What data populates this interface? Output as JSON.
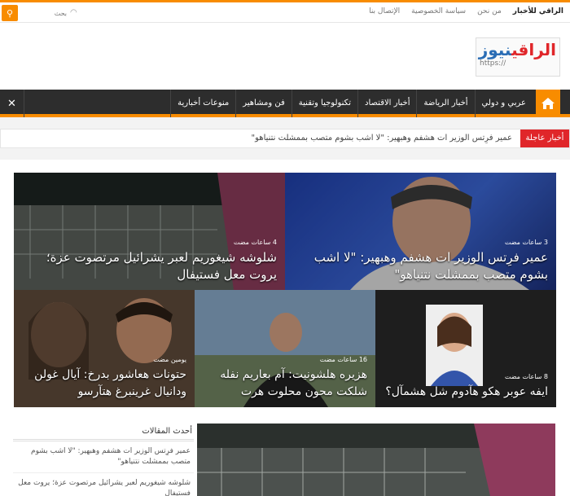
{
  "topbar": {
    "links": [
      "الراقي للأخبار",
      "من نحن",
      "سياسة الخصوصية",
      "الإتصال بنا"
    ],
    "search_placeholder": "بحث"
  },
  "logo": {
    "part1": "الراقي",
    "part2": "نيوز",
    "url": "https://"
  },
  "nav": {
    "items": [
      "عربي و دولي",
      "أخبار الرياضة",
      "أخبار الاقتصاد",
      "تكنولوجيا وتقنية",
      "فن ومشاهير",
      "منوعات أخبارية"
    ]
  },
  "ticker": {
    "label": "أخبار عاجلة",
    "text": "عمير فرِتس الوزير ات هشفم وهبهير: \"لا اشب بشوم متصب بممشلت نتنياهو\""
  },
  "tiles": [
    {
      "time": "3 ساعات مضت",
      "title": "عمير فرِتس الوزير ات هشفم وهبهير: \"لا اشب بشوم متصب بممشلت نتنياهو\""
    },
    {
      "time": "4 ساعات مضت",
      "title": "شلوشه شيغوريم لعبر يشرائيل مرتصوت عزة؛ يروت معل فستيفال"
    },
    {
      "time": "8 ساعات مضت",
      "title": "ايفه عوبر هكو هآدوم شل هشمآل؟"
    },
    {
      "time": "16 ساعات مضت",
      "title": "هزيره هلشونيت: آم بعاريم نفله شلكت محون محلوت هرت"
    },
    {
      "time": "يومين مضت",
      "title": "حتونات هعاشور بدرخ: آيال غولن ودانيال غرينبرغ هتآرسو"
    }
  ],
  "sidebar": {
    "title": "أحدث المقالات",
    "items": [
      "عمير فرِتس الوزير ات هشفم وهبهير: \"لا اشب بشوم متصب بممشلت نتنياهو\"",
      "شلوشه شيغوريم لعبر يشرائيل مرتصوت عزة؛ يروت معل فستيفال"
    ]
  }
}
